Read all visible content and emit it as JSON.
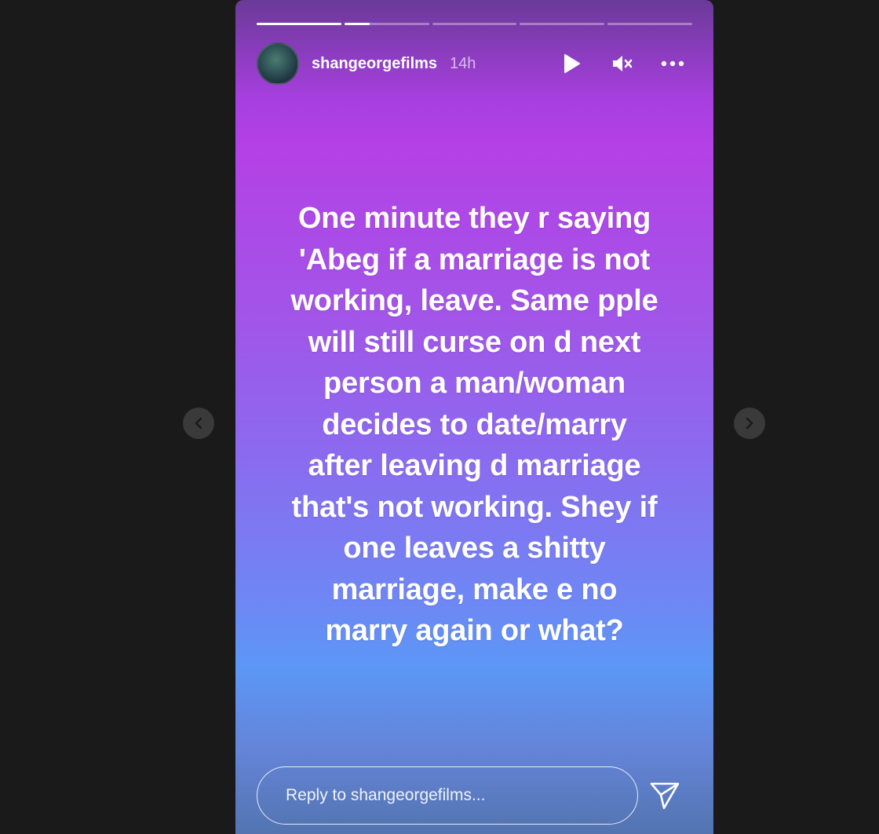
{
  "story": {
    "progress": [
      1,
      0.3,
      0,
      0,
      0
    ],
    "username": "shangeorgefilms",
    "time_ago": "14h",
    "text": "One minute they r saying\n'Abeg if a marriage is not\nworking, leave. Same pple\nwill still curse on d next\nperson a man/woman\ndecides to date/marry\nafter leaving d marriage\nthat's not working. Shey if\none leaves a shitty\nmarriage, make e no\nmarry again or what?",
    "reply_placeholder": "Reply to shangeorgefilms...",
    "icons": {
      "play": "play-icon",
      "mute": "muted-speaker-icon",
      "more": "more-icon",
      "send": "send-icon",
      "prev": "chevron-left-icon",
      "next": "chevron-right-icon"
    }
  }
}
